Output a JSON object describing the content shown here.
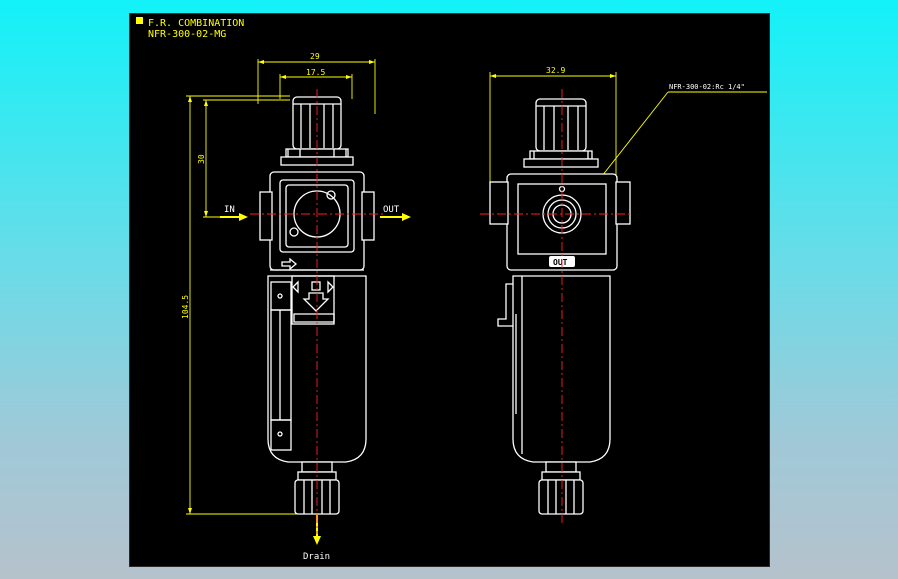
{
  "title": {
    "line1": "F.R. COMBINATION",
    "line2": "NFR-300-02-MG"
  },
  "dimensions": {
    "width_total": "29",
    "width_inner": "17.5",
    "height_upper": "30",
    "height_total": "104.5",
    "width_side": "32.9"
  },
  "labels": {
    "in": "IN",
    "out": "OUT",
    "drain": "Drain",
    "out_plate": "OUT",
    "port_callout": "NFR-300-02:Rc 1/4\""
  },
  "colors": {
    "background": "#000000",
    "outline": "#ffffff",
    "dimension": "#ffff00",
    "centerline": "#ff2020"
  }
}
